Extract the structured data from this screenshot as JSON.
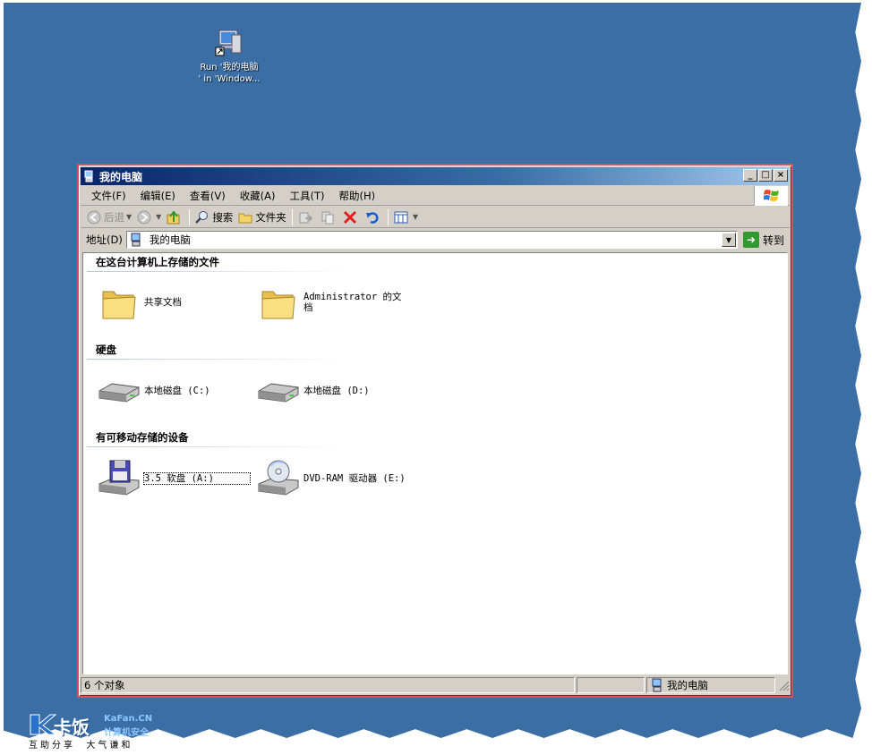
{
  "desktop": {
    "shortcut": {
      "label_line1": "Run '我的电脑",
      "label_line2": "' in 'Window..."
    }
  },
  "window": {
    "title": "我的电脑",
    "title_buttons": [
      "_",
      "□",
      "×"
    ],
    "menu": [
      "文件(F)",
      "编辑(E)",
      "查看(V)",
      "收藏(A)",
      "工具(T)",
      "帮助(H)"
    ],
    "toolbar": {
      "back": "后退",
      "search": "搜索",
      "folders": "文件夹"
    },
    "address": {
      "label": "地址(D)",
      "value": "我的电脑",
      "go": "转到"
    },
    "groups": [
      {
        "header": "在这台计算机上存储的文件",
        "items": [
          "共享文档",
          "Administrator 的文档"
        ]
      },
      {
        "header": "硬盘",
        "items": [
          "本地磁盘 (C:)",
          "本地磁盘 (D:)"
        ]
      },
      {
        "header": "有可移动存储的设备",
        "items": [
          "3.5 软盘 (A:)",
          "DVD-RAM 驱动器 (E:)"
        ]
      }
    ],
    "status": {
      "count": "6 个对象",
      "location": "我的电脑"
    }
  },
  "watermark": {
    "brand": "卡饭",
    "site": "KaFan.CN",
    "tag1": "计算机安全",
    "slogan": "互助分享  大气谦和"
  },
  "colors": {
    "desktop": "#3a6ea5",
    "titlebar_start": "#0a246a",
    "titlebar_end": "#a6caf0",
    "window_border": "#d9505a"
  }
}
